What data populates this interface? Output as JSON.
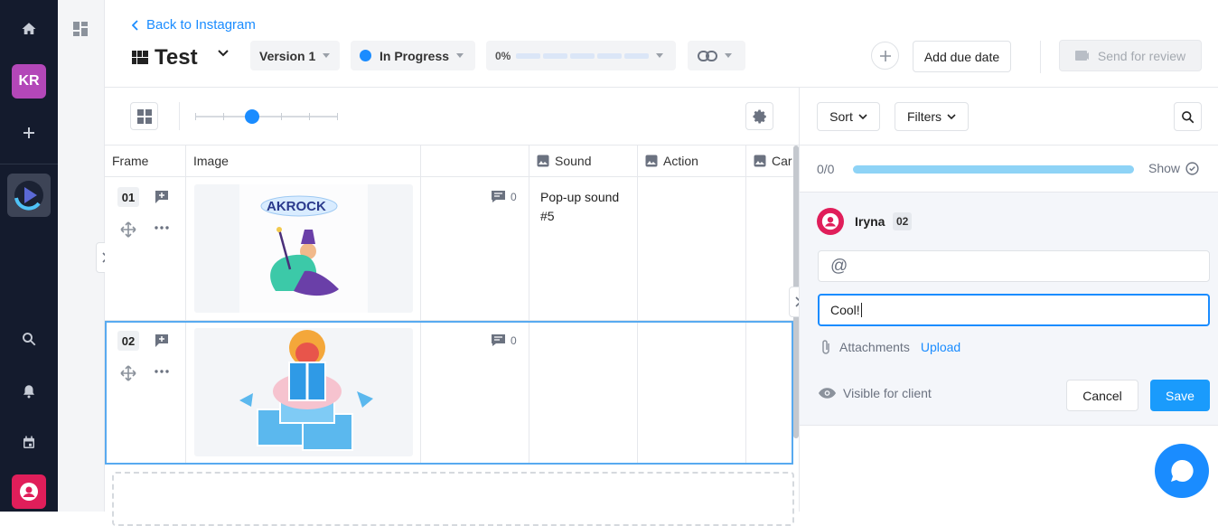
{
  "rail": {
    "avatar_initials": "KR"
  },
  "header": {
    "back_link": "Back to Instagram",
    "title": "Test",
    "version": "Version 1",
    "status": "In Progress",
    "progress_label": "0%",
    "progress_fraction": 0,
    "add_due_date": "Add due date",
    "send_for_review": "Send for review"
  },
  "grid": {
    "zoom_level_fraction": 0.4,
    "columns": [
      "Frame",
      "Image",
      "",
      "Sound",
      "Action",
      "Car"
    ],
    "rows": [
      {
        "frame": "01",
        "comment_count": "0",
        "sound": "Pop-up sound #5",
        "action": ""
      },
      {
        "frame": "02",
        "comment_count": "0",
        "sound": "",
        "action": ""
      }
    ]
  },
  "panel": {
    "sort_label": "Sort",
    "filters_label": "Filters",
    "progress_count": "0/0",
    "show_label": "Show",
    "comment_author": "Iryna",
    "comment_frame_badge": "02",
    "mention_symbol": "@",
    "comment_text": "Cool!",
    "attachments_label": "Attachments",
    "upload_label": "Upload",
    "visible_label": "Visible for client",
    "cancel_label": "Cancel",
    "save_label": "Save"
  },
  "colors": {
    "accent": "#1a8cff",
    "rail_bg": "#141b2d",
    "avatar_bg": "#b347b8",
    "user_icon_bg": "#e01e5a",
    "progress_bar": "#8ed3f6",
    "save_bg": "#1a9bfc",
    "chat_bubble": "#1a8cff"
  }
}
